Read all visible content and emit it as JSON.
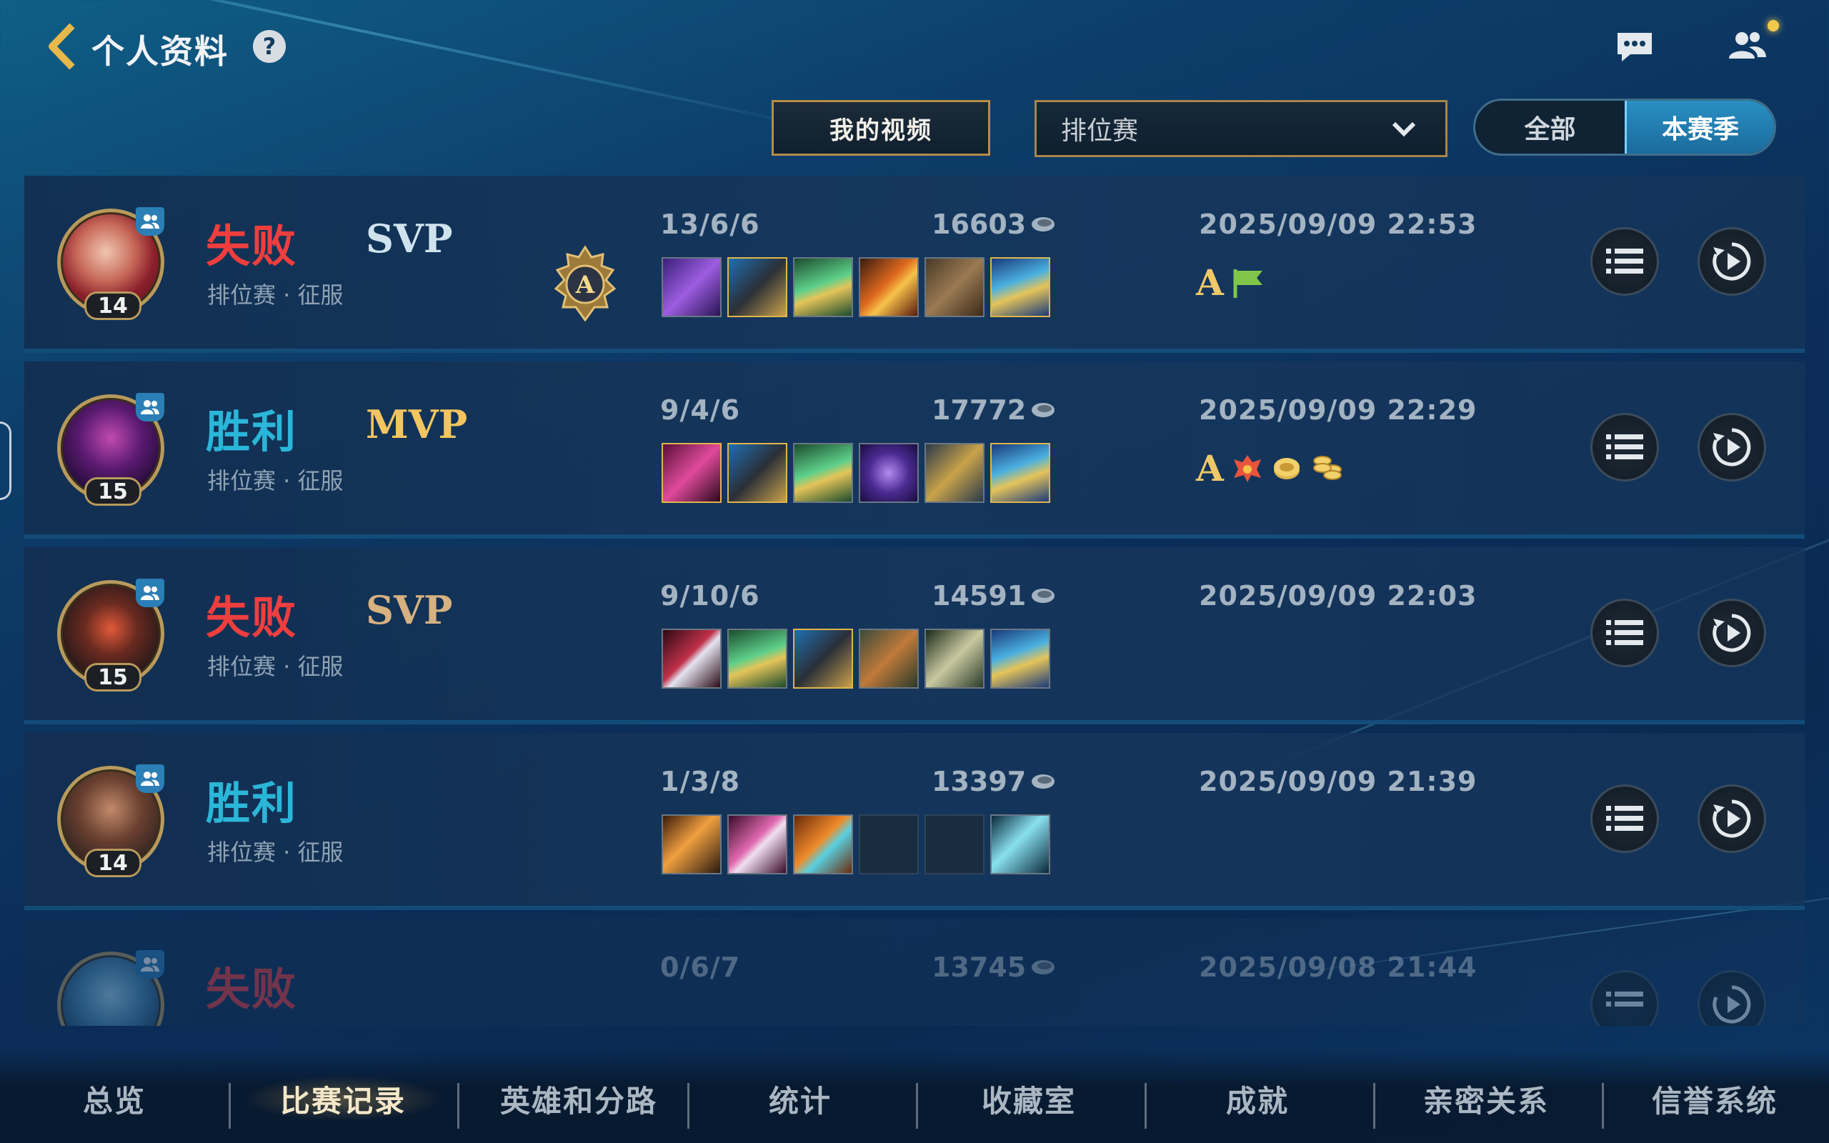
{
  "header": {
    "title": "个人资料",
    "help_glyph": "?"
  },
  "filters": {
    "video_button": "我的视频",
    "mode_selected": "排位赛",
    "season_toggle": [
      "全部",
      "本赛季"
    ],
    "season_active": "本赛季"
  },
  "matches": [
    {
      "result": "失败",
      "result_type": "loss",
      "honor": "SVP",
      "level": "14",
      "mode": "排位赛 · 征服",
      "kda": "13/6/6",
      "gold": "16603",
      "time": "2025/09/09 22:53",
      "grade": "A",
      "has_rank_emblem": true,
      "rank_emblem_letter": "A",
      "badges": [
        "flag-icon"
      ]
    },
    {
      "result": "胜利",
      "result_type": "win",
      "honor": "MVP",
      "level": "15",
      "mode": "排位赛 · 征服",
      "kda": "9/4/6",
      "gold": "17772",
      "time": "2025/09/09 22:29",
      "grade": "A",
      "badges": [
        "dragon-icon",
        "coin-icon",
        "coins-stack-icon"
      ]
    },
    {
      "result": "失败",
      "result_type": "loss",
      "honor": "SVP",
      "level": "15",
      "mode": "排位赛 · 征服",
      "kda": "9/10/6",
      "gold": "14591",
      "time": "2025/09/09 22:03",
      "grade": "",
      "badges": []
    },
    {
      "result": "胜利",
      "result_type": "win",
      "honor": "",
      "level": "14",
      "mode": "排位赛 · 征服",
      "kda": "1/3/8",
      "gold": "13397",
      "time": "2025/09/09 21:39",
      "grade": "",
      "badges": []
    },
    {
      "result": "失败",
      "result_type": "loss",
      "honor": "",
      "level": "",
      "mode": "",
      "kda": "0/6/7",
      "gold": "13745",
      "time": "2025/09/08 21:44",
      "grade": "",
      "badges": []
    }
  ],
  "nav": [
    "总览",
    "比赛记录",
    "英雄和分路",
    "统计",
    "收藏室",
    "成就",
    "亲密关系",
    "信誉系统"
  ],
  "nav_active": "比赛记录",
  "colors": {
    "loss": "#ef3e3e",
    "win": "#2ab6d8",
    "accent_gold": "#b58d4a"
  }
}
